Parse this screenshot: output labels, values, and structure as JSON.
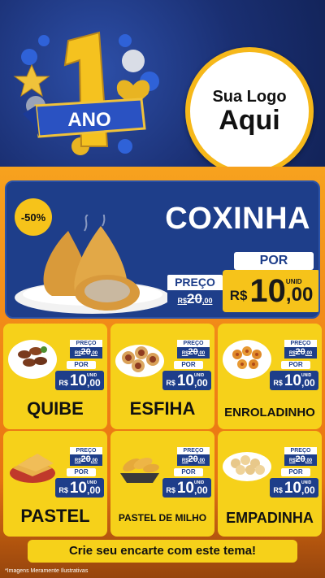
{
  "header": {
    "badge_text": "ANO",
    "badge_number": "1",
    "logo_line1": "Sua Logo",
    "logo_line2": "Aqui"
  },
  "featured": {
    "discount": "-50%",
    "name": "COXINHA",
    "old_label": "PREÇO",
    "old_currency": "R$",
    "old_int": "20",
    "old_dec": ",00",
    "por_label": "POR",
    "new_currency": "R$",
    "new_int": "10",
    "new_dec": ",00",
    "unit": "UNID"
  },
  "products": [
    {
      "name": "QUIBE",
      "old_label": "PREÇO",
      "old_currency": "R$",
      "old_int": "20",
      "old_dec": ",00",
      "por_label": "POR",
      "new_currency": "R$",
      "new_int": "10",
      "new_dec": ",00",
      "unit": "UNID"
    },
    {
      "name": "ESFIHA",
      "old_label": "PREÇO",
      "old_currency": "R$",
      "old_int": "20",
      "old_dec": ",00",
      "por_label": "POR",
      "new_currency": "R$",
      "new_int": "10",
      "new_dec": ",00",
      "unit": "UNID"
    },
    {
      "name": "ENROLADINHO",
      "old_label": "PREÇO",
      "old_currency": "R$",
      "old_int": "20",
      "old_dec": ",00",
      "por_label": "POR",
      "new_currency": "R$",
      "new_int": "10",
      "new_dec": ",00",
      "unit": "UNID"
    },
    {
      "name": "PASTEL",
      "old_label": "PREÇO",
      "old_currency": "R$",
      "old_int": "20",
      "old_dec": ",00",
      "por_label": "POR",
      "new_currency": "R$",
      "new_int": "10",
      "new_dec": ",00",
      "unit": "UNID"
    },
    {
      "name": "PASTEL DE MILHO",
      "old_label": "PREÇO",
      "old_currency": "R$",
      "old_int": "20",
      "old_dec": ",00",
      "por_label": "POR",
      "new_currency": "R$",
      "new_int": "10",
      "new_dec": ",00",
      "unit": "UNID"
    },
    {
      "name": "EMPADINHA",
      "old_label": "PREÇO",
      "old_currency": "R$",
      "old_int": "20",
      "old_dec": ",00",
      "por_label": "POR",
      "new_currency": "R$",
      "new_int": "10",
      "new_dec": ",00",
      "unit": "UNID"
    }
  ],
  "cta": "Crie seu encarte com este tema!",
  "disclaimer": "*Imagens Meramente Ilustrativas",
  "colors": {
    "navy": "#1e3e8a",
    "yellow": "#f6d11a",
    "orange": "#ee7d15"
  }
}
